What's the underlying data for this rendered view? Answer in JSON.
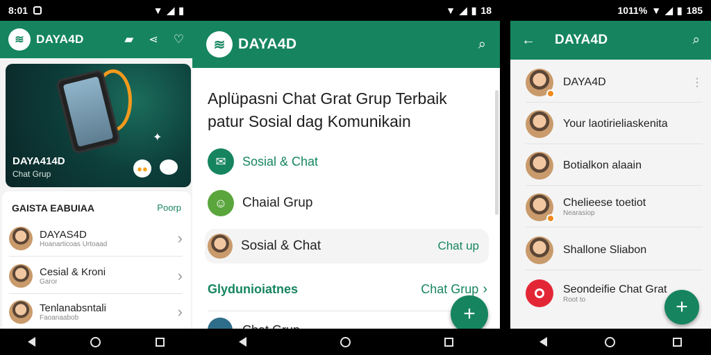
{
  "s1": {
    "status": {
      "time": "8:01",
      "right": ""
    },
    "app_title": "DAYA4D",
    "hero": {
      "title": "DAYA414D",
      "subtitle": "Chat Grup"
    },
    "section": {
      "title": "GAISTA EABUIAA",
      "action": "Poorp"
    },
    "rows": [
      {
        "name": "DAYAS4D",
        "sub": "Hoanarticoas Urtoaad"
      },
      {
        "name": "Cesial & Kroni",
        "sub": "Garor"
      },
      {
        "name": "Tenlanabsntali",
        "sub": "Faoanaabob"
      }
    ]
  },
  "s2": {
    "status": {
      "right": "18"
    },
    "app_title": "DAYA4D",
    "headline_line1": "Aplüpasni Chat Grat Grup Terbaik",
    "headline_line2": "patur Sosial dag Komunikain",
    "items": [
      {
        "label": "Sosial & Chat",
        "action": ""
      },
      {
        "label": "Chaial Grup",
        "action": ""
      },
      {
        "label": "Sosial & Chat",
        "action": "Chat up"
      }
    ],
    "group_row": {
      "label": "Glydunioiatnes",
      "action": "Chat Grup"
    },
    "partial_row": "Chat Grup"
  },
  "s3": {
    "status": {
      "left": "1011%",
      "right": "185"
    },
    "app_title": "DAYA4D",
    "rows": [
      {
        "name": "DAYA4D",
        "sub": ""
      },
      {
        "name": "Your laotirieliaskenita",
        "sub": ""
      },
      {
        "name": "Botialkon alaain",
        "sub": ""
      },
      {
        "name": "Chelieese toetiot",
        "sub": "Nearasiop"
      },
      {
        "name": "Shallone Sliabon",
        "sub": ""
      },
      {
        "name": "Seondeifie Chat Grat",
        "sub": "Root to"
      }
    ]
  },
  "colors": {
    "primary": "#16855f",
    "accent": "#f08a1c"
  }
}
